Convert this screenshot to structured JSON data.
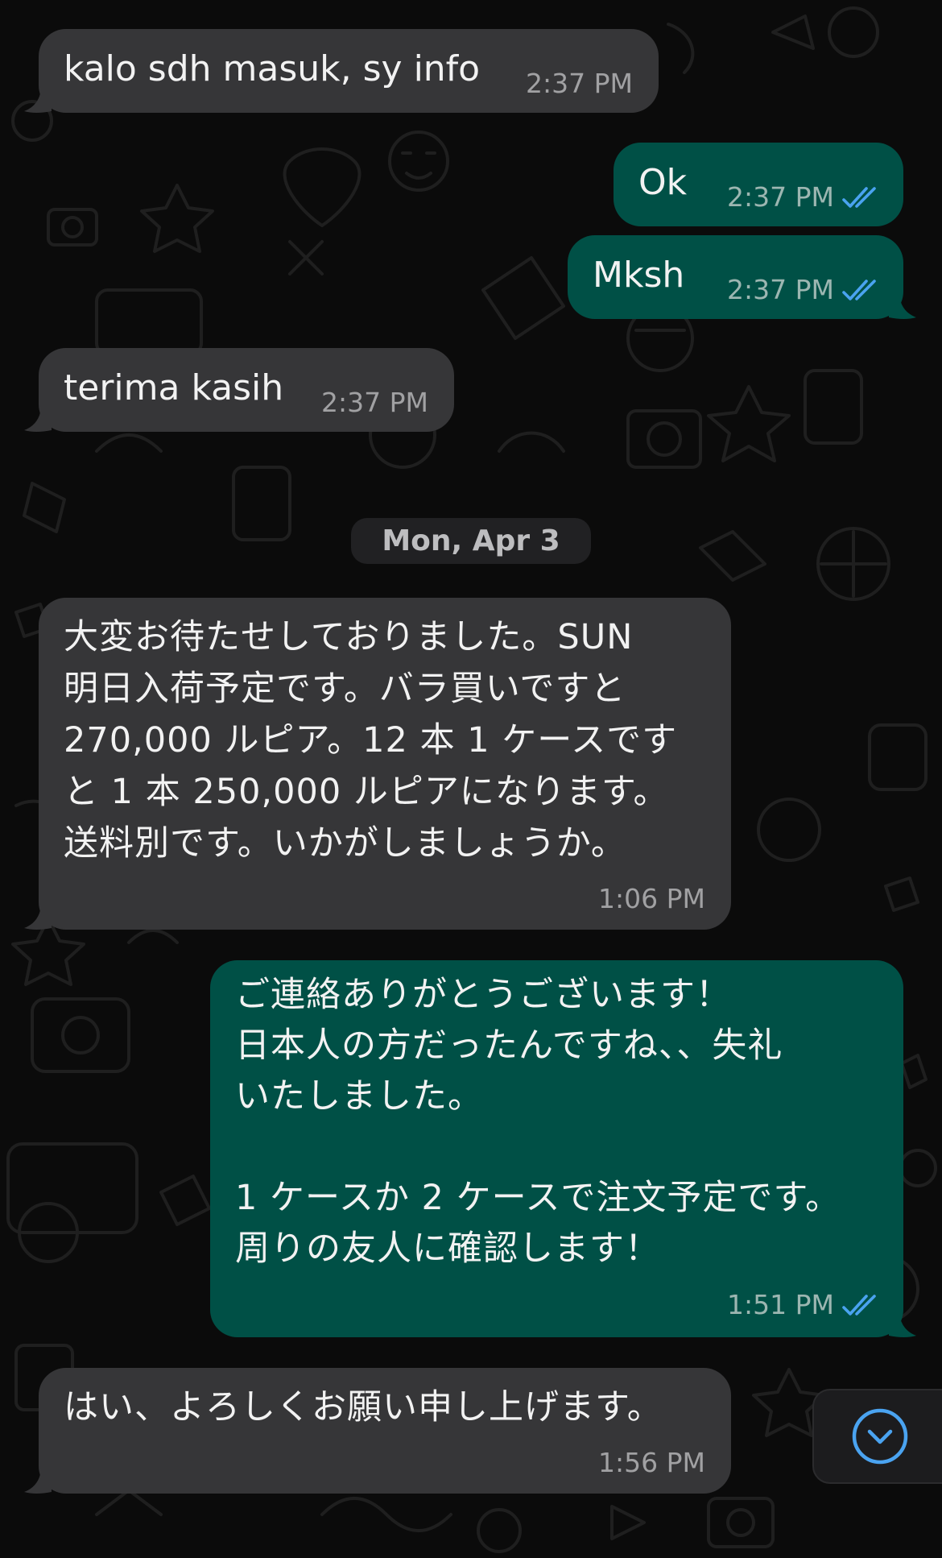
{
  "date_separator": "Mon, Apr 3",
  "colors": {
    "background": "#0b0b0b",
    "incoming_bubble": "#363638",
    "outgoing_bubble": "#005046",
    "read_ticks": "#4aa3f0",
    "timestamp": "#a1a1a3"
  },
  "messages": [
    {
      "direction": "incoming",
      "text": "kalo sdh masuk, sy info",
      "time": "2:37 PM"
    },
    {
      "direction": "outgoing",
      "text": "Ok",
      "time": "2:37 PM",
      "status": "read"
    },
    {
      "direction": "outgoing",
      "text": "Mksh",
      "time": "2:37 PM",
      "status": "read"
    },
    {
      "direction": "incoming",
      "text": "terima kasih",
      "time": "2:37 PM"
    },
    {
      "direction": "incoming",
      "lines": [
        "大変お待たせしておりました。SUN",
        "明日入荷予定です。バラ買いですと",
        "270,000 ルピア。12 本 1 ケースです",
        "と 1 本 250,000 ルピアになります。",
        "送料別です。いかがしましょうか。"
      ],
      "time": "1:06 PM"
    },
    {
      "direction": "outgoing",
      "lines": [
        "ご連絡ありがとうございます！",
        "日本人の方だったんですね、、失礼",
        "いたしました。",
        "",
        "1 ケースか 2 ケースで注文予定です。",
        "周りの友人に確認します！"
      ],
      "time": "1:51 PM",
      "status": "read"
    },
    {
      "direction": "incoming",
      "text": "はい、よろしくお願い申し上げます。",
      "time": "1:56 PM"
    }
  ],
  "scroll_button": {
    "icon": "chevron-down-circle-icon"
  }
}
